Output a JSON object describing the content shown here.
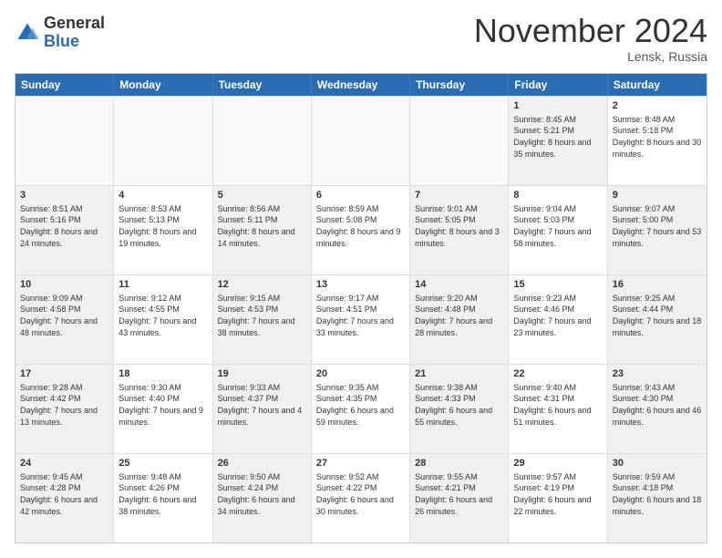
{
  "logo": {
    "general": "General",
    "blue": "Blue"
  },
  "title": "November 2024",
  "location": "Lensk, Russia",
  "header_days": [
    "Sunday",
    "Monday",
    "Tuesday",
    "Wednesday",
    "Thursday",
    "Friday",
    "Saturday"
  ],
  "rows": [
    [
      {
        "day": "",
        "text": "",
        "empty": true
      },
      {
        "day": "",
        "text": "",
        "empty": true
      },
      {
        "day": "",
        "text": "",
        "empty": true
      },
      {
        "day": "",
        "text": "",
        "empty": true
      },
      {
        "day": "",
        "text": "",
        "empty": true
      },
      {
        "day": "1",
        "text": "Sunrise: 8:45 AM\nSunset: 5:21 PM\nDaylight: 8 hours and 35 minutes.",
        "shaded": true
      },
      {
        "day": "2",
        "text": "Sunrise: 8:48 AM\nSunset: 5:18 PM\nDaylight: 8 hours and 30 minutes.",
        "shaded": false
      }
    ],
    [
      {
        "day": "3",
        "text": "Sunrise: 8:51 AM\nSunset: 5:16 PM\nDaylight: 8 hours and 24 minutes.",
        "shaded": true
      },
      {
        "day": "4",
        "text": "Sunrise: 8:53 AM\nSunset: 5:13 PM\nDaylight: 8 hours and 19 minutes.",
        "shaded": false
      },
      {
        "day": "5",
        "text": "Sunrise: 8:56 AM\nSunset: 5:11 PM\nDaylight: 8 hours and 14 minutes.",
        "shaded": true
      },
      {
        "day": "6",
        "text": "Sunrise: 8:59 AM\nSunset: 5:08 PM\nDaylight: 8 hours and 9 minutes.",
        "shaded": false
      },
      {
        "day": "7",
        "text": "Sunrise: 9:01 AM\nSunset: 5:05 PM\nDaylight: 8 hours and 3 minutes.",
        "shaded": true
      },
      {
        "day": "8",
        "text": "Sunrise: 9:04 AM\nSunset: 5:03 PM\nDaylight: 7 hours and 58 minutes.",
        "shaded": false
      },
      {
        "day": "9",
        "text": "Sunrise: 9:07 AM\nSunset: 5:00 PM\nDaylight: 7 hours and 53 minutes.",
        "shaded": true
      }
    ],
    [
      {
        "day": "10",
        "text": "Sunrise: 9:09 AM\nSunset: 4:58 PM\nDaylight: 7 hours and 48 minutes.",
        "shaded": true
      },
      {
        "day": "11",
        "text": "Sunrise: 9:12 AM\nSunset: 4:55 PM\nDaylight: 7 hours and 43 minutes.",
        "shaded": false
      },
      {
        "day": "12",
        "text": "Sunrise: 9:15 AM\nSunset: 4:53 PM\nDaylight: 7 hours and 38 minutes.",
        "shaded": true
      },
      {
        "day": "13",
        "text": "Sunrise: 9:17 AM\nSunset: 4:51 PM\nDaylight: 7 hours and 33 minutes.",
        "shaded": false
      },
      {
        "day": "14",
        "text": "Sunrise: 9:20 AM\nSunset: 4:48 PM\nDaylight: 7 hours and 28 minutes.",
        "shaded": true
      },
      {
        "day": "15",
        "text": "Sunrise: 9:23 AM\nSunset: 4:46 PM\nDaylight: 7 hours and 23 minutes.",
        "shaded": false
      },
      {
        "day": "16",
        "text": "Sunrise: 9:25 AM\nSunset: 4:44 PM\nDaylight: 7 hours and 18 minutes.",
        "shaded": true
      }
    ],
    [
      {
        "day": "17",
        "text": "Sunrise: 9:28 AM\nSunset: 4:42 PM\nDaylight: 7 hours and 13 minutes.",
        "shaded": true
      },
      {
        "day": "18",
        "text": "Sunrise: 9:30 AM\nSunset: 4:40 PM\nDaylight: 7 hours and 9 minutes.",
        "shaded": false
      },
      {
        "day": "19",
        "text": "Sunrise: 9:33 AM\nSunset: 4:37 PM\nDaylight: 7 hours and 4 minutes.",
        "shaded": true
      },
      {
        "day": "20",
        "text": "Sunrise: 9:35 AM\nSunset: 4:35 PM\nDaylight: 6 hours and 59 minutes.",
        "shaded": false
      },
      {
        "day": "21",
        "text": "Sunrise: 9:38 AM\nSunset: 4:33 PM\nDaylight: 6 hours and 55 minutes.",
        "shaded": true
      },
      {
        "day": "22",
        "text": "Sunrise: 9:40 AM\nSunset: 4:31 PM\nDaylight: 6 hours and 51 minutes.",
        "shaded": false
      },
      {
        "day": "23",
        "text": "Sunrise: 9:43 AM\nSunset: 4:30 PM\nDaylight: 6 hours and 46 minutes.",
        "shaded": true
      }
    ],
    [
      {
        "day": "24",
        "text": "Sunrise: 9:45 AM\nSunset: 4:28 PM\nDaylight: 6 hours and 42 minutes.",
        "shaded": true
      },
      {
        "day": "25",
        "text": "Sunrise: 9:48 AM\nSunset: 4:26 PM\nDaylight: 6 hours and 38 minutes.",
        "shaded": false
      },
      {
        "day": "26",
        "text": "Sunrise: 9:50 AM\nSunset: 4:24 PM\nDaylight: 6 hours and 34 minutes.",
        "shaded": true
      },
      {
        "day": "27",
        "text": "Sunrise: 9:52 AM\nSunset: 4:22 PM\nDaylight: 6 hours and 30 minutes.",
        "shaded": false
      },
      {
        "day": "28",
        "text": "Sunrise: 9:55 AM\nSunset: 4:21 PM\nDaylight: 6 hours and 26 minutes.",
        "shaded": true
      },
      {
        "day": "29",
        "text": "Sunrise: 9:57 AM\nSunset: 4:19 PM\nDaylight: 6 hours and 22 minutes.",
        "shaded": false
      },
      {
        "day": "30",
        "text": "Sunrise: 9:59 AM\nSunset: 4:18 PM\nDaylight: 6 hours and 18 minutes.",
        "shaded": true
      }
    ]
  ]
}
